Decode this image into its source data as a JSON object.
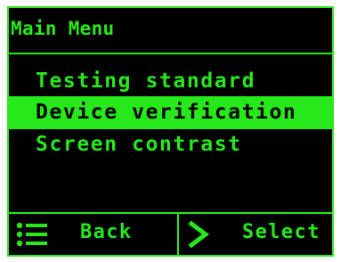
{
  "header": {
    "title": "Main Menu"
  },
  "menu": {
    "items": [
      {
        "label": "Testing standard",
        "selected": false
      },
      {
        "label": "Device verification",
        "selected": true
      },
      {
        "label": "Screen contrast",
        "selected": false
      }
    ]
  },
  "footer": {
    "back": {
      "label": "Back",
      "icon": "list-icon"
    },
    "select": {
      "label": "Select",
      "icon": "chevron-right-icon"
    }
  },
  "colors": {
    "accent": "#26e81a",
    "background": "#000000",
    "frame": "#ffffff"
  }
}
